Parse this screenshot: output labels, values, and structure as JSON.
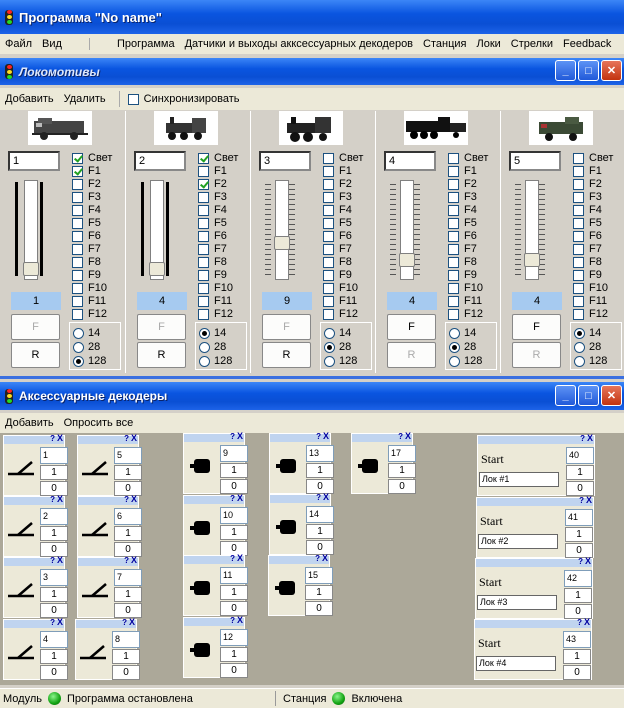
{
  "app": {
    "title": "Программа  \"No name\""
  },
  "menu": [
    "Файл",
    "Вид",
    "Программа",
    "Датчики и выходы акксессуарных декодеров",
    "Станция",
    "Локи",
    "Стрелки",
    "Feedback"
  ],
  "loco_window": {
    "title": "Локомотивы",
    "toolbar": {
      "add": "Добавить",
      "remove": "Удалить",
      "sync": "Синхронизировать"
    }
  },
  "function_labels": [
    "Свет",
    "F1",
    "F2",
    "F3",
    "F4",
    "F5",
    "F6",
    "F7",
    "F8",
    "F9",
    "F10",
    "F11",
    "F12"
  ],
  "speed_steps": [
    "14",
    "28",
    "128"
  ],
  "buttons": {
    "f": "F",
    "r": "R"
  },
  "locos": [
    {
      "address": "1",
      "speed": "1",
      "checked": [
        0,
        1
      ],
      "step": "128",
      "f_active": false,
      "r_disabled": false,
      "slider": 0.95
    },
    {
      "address": "2",
      "speed": "4",
      "checked": [
        0,
        2
      ],
      "step": "14",
      "f_active": false,
      "r_disabled": false,
      "slider": 0.95
    },
    {
      "address": "3",
      "speed": "9",
      "checked": [],
      "step": "28",
      "f_active": false,
      "r_disabled": false,
      "slider": 0.65
    },
    {
      "address": "4",
      "speed": "4",
      "checked": [],
      "step": "28",
      "f_active": true,
      "r_disabled": true,
      "slider": 0.85
    },
    {
      "address": "5",
      "speed": "4",
      "checked": [],
      "step": "14",
      "f_active": true,
      "r_disabled": true,
      "slider": 0.85
    }
  ],
  "acc_window": {
    "title": "Аксессуарные декодеры",
    "toolbar": {
      "add": "Добавить",
      "poll": "Опросить все"
    }
  },
  "acc": {
    "on": "1",
    "off": "0",
    "help": "?",
    "close": "X"
  },
  "turnouts": [
    "1",
    "2",
    "3",
    "4",
    "5",
    "6",
    "7",
    "8"
  ],
  "signals": [
    "9",
    "10",
    "11",
    "12",
    "13",
    "14",
    "15",
    "17"
  ],
  "starts": [
    {
      "label": "Start",
      "loco": "Лок #1",
      "num": "40"
    },
    {
      "label": "Start",
      "loco": "Лок #2",
      "num": "41"
    },
    {
      "label": "Start",
      "loco": "Лок #3",
      "num": "42"
    },
    {
      "label": "Start",
      "loco": "Лок #4",
      "num": "43"
    }
  ],
  "status": {
    "module": "Модуль",
    "module_state": "Программа остановлена",
    "station": "Станция",
    "station_state": "Включена"
  }
}
